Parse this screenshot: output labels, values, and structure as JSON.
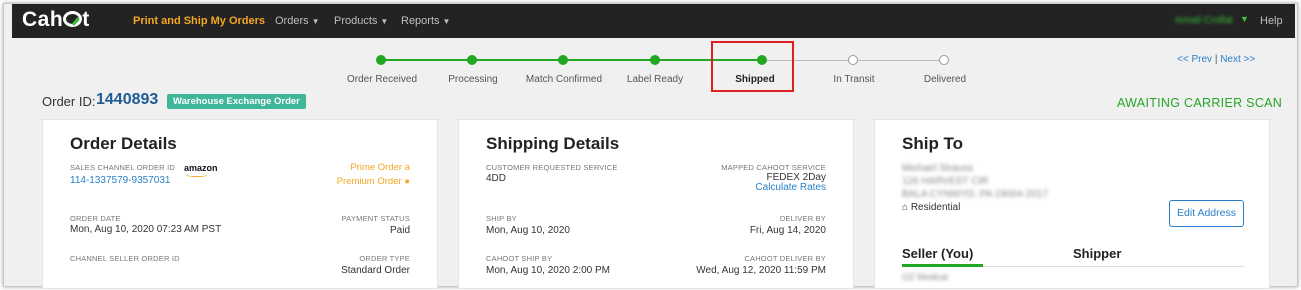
{
  "nav": {
    "logo": "Cahoot",
    "items": [
      {
        "label": "Print and Ship My Orders",
        "active": true
      },
      {
        "label": "Orders",
        "dropdown": true
      },
      {
        "label": "Products",
        "dropdown": true
      },
      {
        "label": "Reports",
        "dropdown": true
      }
    ],
    "user_name": "Ismail Crollat",
    "help": "Help"
  },
  "progress": {
    "steps": [
      {
        "label": "Order Received",
        "done": true
      },
      {
        "label": "Processing",
        "done": true
      },
      {
        "label": "Match Confirmed",
        "done": true
      },
      {
        "label": "Label Ready",
        "done": true
      },
      {
        "label": "Shipped",
        "done": true,
        "current": true
      },
      {
        "label": "In Transit",
        "done": false
      },
      {
        "label": "Delivered",
        "done": false
      }
    ],
    "colors": {
      "done": "#22a722",
      "todo": "#9a9a9a",
      "highlight": "#e02020"
    }
  },
  "pager": {
    "prev": "<< Prev",
    "separator": "|",
    "next": "Next >>"
  },
  "order": {
    "id_label": "Order ID:",
    "id": "1440893",
    "badge": "Warehouse Exchange Order",
    "status": "AWAITING CARRIER SCAN"
  },
  "order_details": {
    "title": "Order Details",
    "sales_channel_label": "SALES CHANNEL ORDER ID",
    "channel_logo": "amazon",
    "sales_channel_id": "114-1337579-9357031",
    "prime_order": "Prime Order",
    "premium_order": "Premium Order",
    "order_date_label": "ORDER DATE",
    "order_date": "Mon, Aug 10, 2020 07:23 AM PST",
    "payment_status_label": "PAYMENT STATUS",
    "payment_status": "Paid",
    "channel_seller_label": "CHANNEL SELLER ORDER ID",
    "order_type_label": "ORDER TYPE",
    "order_type": "Standard Order"
  },
  "shipping_details": {
    "title": "Shipping Details",
    "customer_service_label": "CUSTOMER REQUESTED SERVICE",
    "customer_service": "4DD",
    "mapped_service_label": "MAPPED CAHOOT SERVICE",
    "mapped_service": "FEDEX 2Day",
    "calculate_rates": "Calculate Rates",
    "ship_by_label": "SHIP BY",
    "ship_by": "Mon, Aug 10, 2020",
    "deliver_by_label": "DELIVER BY",
    "deliver_by": "Fri, Aug 14, 2020",
    "cahoot_ship_by_label": "CAHOOT SHIP BY",
    "cahoot_ship_by": "Mon, Aug 10, 2020 2:00 PM",
    "cahoot_deliver_by_label": "CAHOOT DELIVER BY",
    "cahoot_deliver_by": "Wed, Aug 12, 2020 11:59 PM"
  },
  "ship_to": {
    "title": "Ship To",
    "name": "Michael Strauss",
    "address1": "126 HARVEST CIR",
    "address2": "BALA CYNWYD, PA 19004-2017",
    "residential": "Residential",
    "edit_address": "Edit Address",
    "tab_seller": "Seller (You)",
    "tab_shipper": "Shipper",
    "seller_name": "OZ Medical"
  }
}
